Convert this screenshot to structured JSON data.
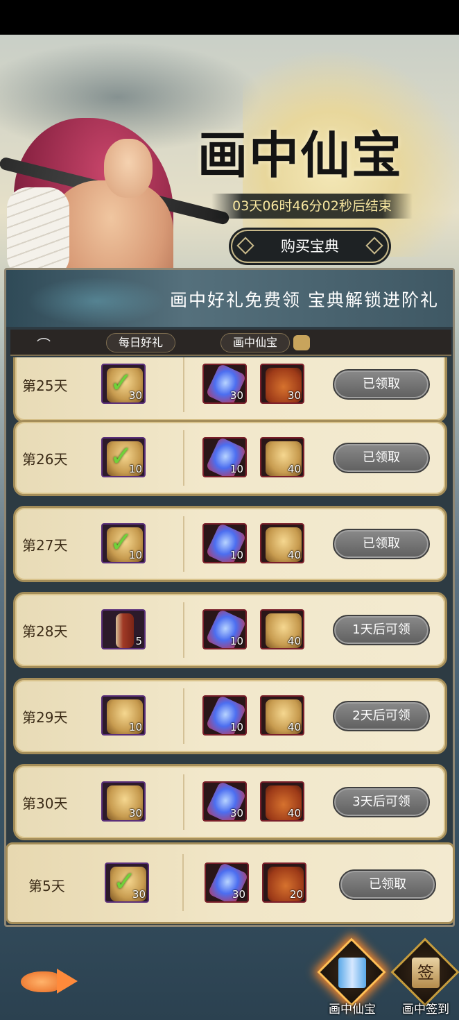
{
  "header": {
    "title": "画中仙宝",
    "timer": "03天06时46分02秒后结束",
    "buy_button": "购买宝典",
    "slogan": "画中好礼免费领  宝典解锁进阶礼"
  },
  "tabs": {
    "daily": "每日好礼",
    "treasure": "画中仙宝"
  },
  "rows": [
    {
      "day": "第25天",
      "free": {
        "qty": "30",
        "icon": "bell-token-icon",
        "claimed": true
      },
      "paid": [
        {
          "qty": "30",
          "icon": "crystal-icon"
        },
        {
          "qty": "30",
          "icon": "treasure-bag-icon"
        }
      ],
      "button": "已领取"
    },
    {
      "day": "第26天",
      "free": {
        "qty": "10",
        "icon": "bell-token-icon",
        "claimed": true
      },
      "paid": [
        {
          "qty": "10",
          "icon": "crystal-icon"
        },
        {
          "qty": "40",
          "icon": "bell-token-icon"
        }
      ],
      "button": "已领取"
    },
    {
      "day": "第27天",
      "free": {
        "qty": "10",
        "icon": "bell-token-icon",
        "claimed": true
      },
      "paid": [
        {
          "qty": "10",
          "icon": "crystal-icon"
        },
        {
          "qty": "40",
          "icon": "bell-token-icon"
        }
      ],
      "button": "已领取"
    },
    {
      "day": "第28天",
      "free": {
        "qty": "5",
        "icon": "scroll-icon",
        "claimed": false
      },
      "paid": [
        {
          "qty": "10",
          "icon": "crystal-icon"
        },
        {
          "qty": "40",
          "icon": "bell-token-icon"
        }
      ],
      "button": "1天后可领"
    },
    {
      "day": "第29天",
      "free": {
        "qty": "10",
        "icon": "bell-token-icon",
        "claimed": false
      },
      "paid": [
        {
          "qty": "10",
          "icon": "crystal-icon"
        },
        {
          "qty": "40",
          "icon": "bell-token-icon"
        }
      ],
      "button": "2天后可领"
    },
    {
      "day": "第30天",
      "free": {
        "qty": "30",
        "icon": "bell-token-icon",
        "claimed": false
      },
      "paid": [
        {
          "qty": "30",
          "icon": "crystal-icon"
        },
        {
          "qty": "40",
          "icon": "treasure-bag-icon"
        }
      ],
      "button": "3天后可领"
    }
  ],
  "pinned_row": {
    "day": "第5天",
    "free": {
      "qty": "30",
      "icon": "bell-token-icon",
      "claimed": true
    },
    "paid": [
      {
        "qty": "30",
        "icon": "crystal-icon"
      },
      {
        "qty": "20",
        "icon": "treasure-bag-icon"
      }
    ],
    "button": "已领取"
  },
  "bottom_nav": {
    "treasure": "画中仙宝",
    "sign_in": "画中签到",
    "sign_glyph": "签"
  },
  "checkmark": "✓",
  "bird_glyph": "⌒"
}
